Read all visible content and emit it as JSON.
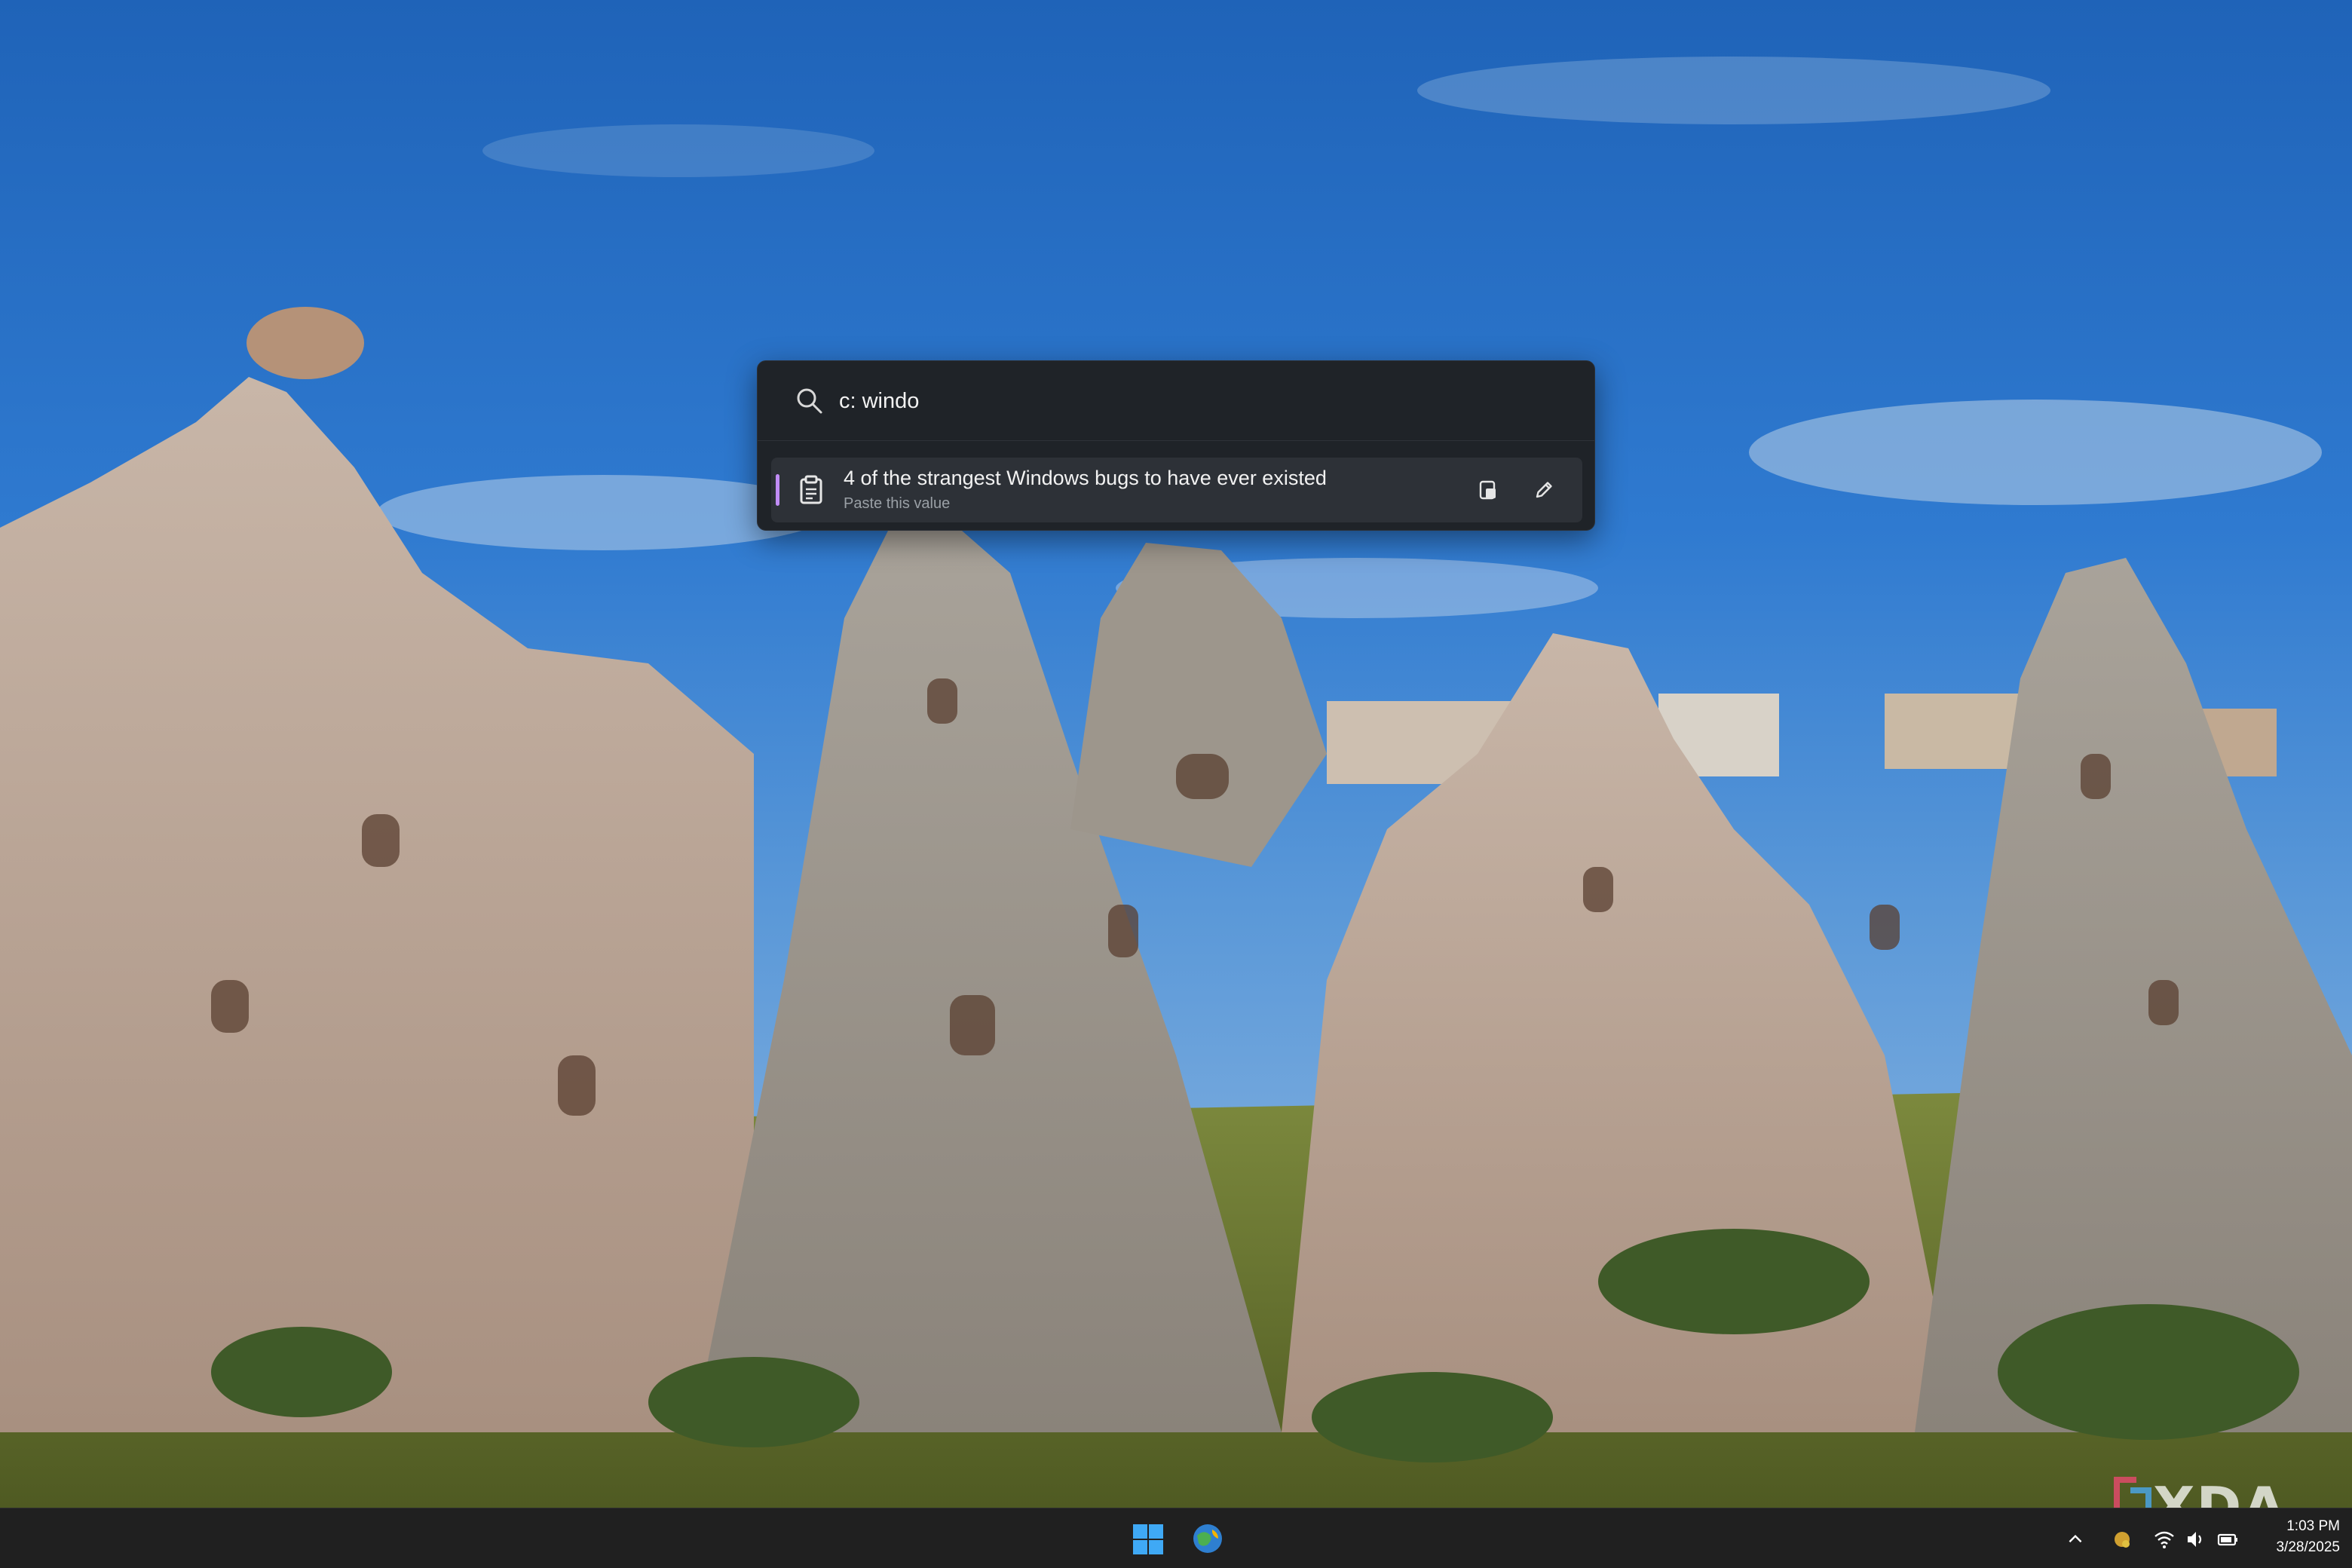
{
  "palette": {
    "search_value": "c: windo",
    "result": {
      "title": "4 of the strangest Windows bugs to have ever existed",
      "subtitle": "Paste this value",
      "accent_color": "#c08cf5"
    }
  },
  "taskbar": {
    "time": "1:03 PM",
    "date": "3/28/2025"
  },
  "watermark": {
    "text": "XDA"
  },
  "icons": {
    "search": "search-icon",
    "clipboard": "clipboard-icon",
    "paste": "paste-icon",
    "edit": "pencil-icon",
    "start": "windows-logo-icon",
    "browser": "browser-icon",
    "chevron": "chevron-up-icon",
    "wifi": "wifi-icon",
    "volume": "volume-icon",
    "battery": "battery-icon"
  }
}
